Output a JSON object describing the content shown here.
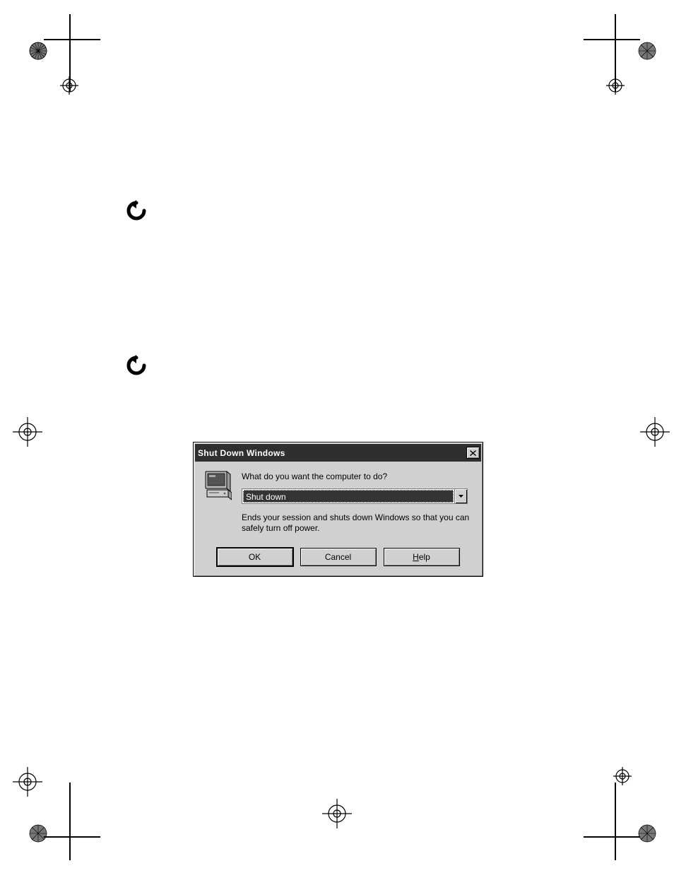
{
  "dialog": {
    "title": "Shut Down Windows",
    "prompt": "What do you want the computer to do?",
    "selected_option": "Shut down",
    "description": "Ends your session and shuts down Windows so that you can safely turn off power.",
    "buttons": {
      "ok": "OK",
      "cancel": "Cancel",
      "help_pre": "H",
      "help_rest": "elp"
    },
    "close_icon_label": "Close"
  }
}
